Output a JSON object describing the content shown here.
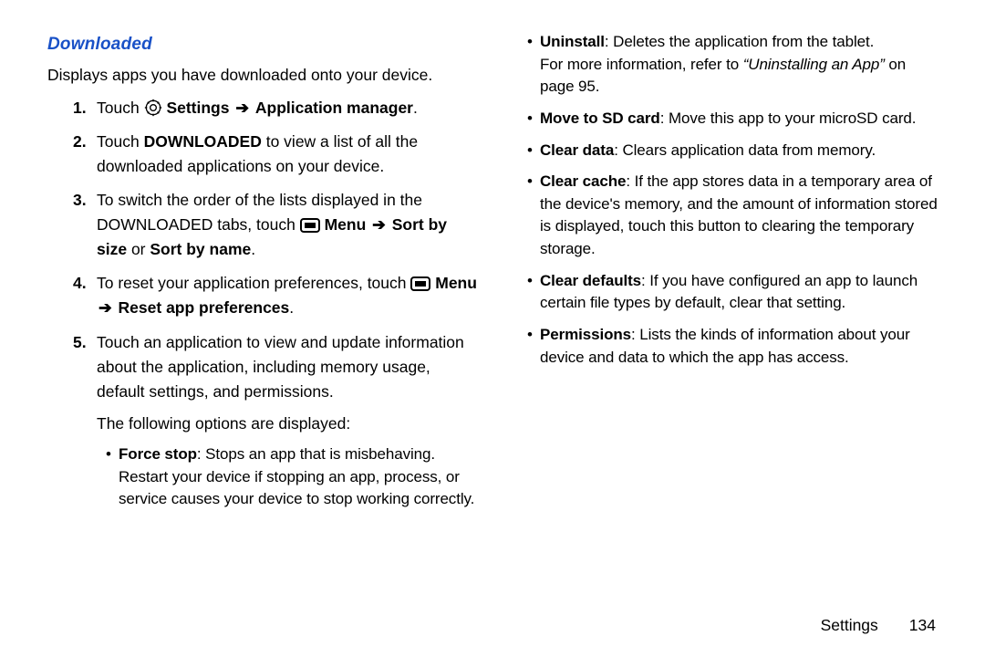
{
  "heading": "Downloaded",
  "intro": "Displays apps you have downloaded onto your device.",
  "arrow": "➔",
  "step1": {
    "num": "1.",
    "t1": "Touch ",
    "settings": "Settings",
    "appmgr": "Application manager",
    "period": "."
  },
  "step2": {
    "num": "2.",
    "t1": "Touch ",
    "downloaded": "DOWNLOADED",
    "t2": " to view a list of all the downloaded applications on your device."
  },
  "step3": {
    "num": "3.",
    "t1": "To switch the order of the lists displayed in the DOWNLOADED tabs, touch ",
    "menu": "Menu",
    "sortbysize": "Sort by size",
    "or": " or ",
    "sortbyname": "Sort by name",
    "period": "."
  },
  "step4": {
    "num": "4.",
    "t1": "To reset your application preferences, touch ",
    "menu": "Menu",
    "reset": "Reset app preferences",
    "period": "."
  },
  "step5": {
    "num": "5.",
    "t1": "Touch an application to view and update information about the application, including memory usage, default settings, and permissions."
  },
  "following": "The following options are displayed:",
  "bullets_left": {
    "forcestop": {
      "label": "Force stop",
      "text": ": Stops an app that is misbehaving. Restart your device if stopping an app, process, or service causes your device to stop working correctly."
    }
  },
  "bullets_right": {
    "uninstall": {
      "label": "Uninstall",
      "t1": ": Deletes the application from the tablet.",
      "more1": "For more information, refer to ",
      "ref": "“Uninstalling an App”",
      "more2": " on page 95."
    },
    "movesd": {
      "label": "Move to SD card",
      "text": ": Move this app to your microSD card."
    },
    "cleardata": {
      "label": "Clear data",
      "text": ": Clears application data from memory."
    },
    "clearcache": {
      "label": "Clear cache",
      "text": ": If the app stores data in a temporary area of the device's memory, and the amount of information stored is displayed, touch this button to clearing the temporary storage."
    },
    "cleardefaults": {
      "label": "Clear defaults",
      "text": ": If you have configured an app to launch certain file types by default, clear that setting."
    },
    "permissions": {
      "label": "Permissions",
      "text": ": Lists the kinds of information about your device and data to which the app has access."
    }
  },
  "footer": {
    "chapter": "Settings",
    "page": "134"
  }
}
